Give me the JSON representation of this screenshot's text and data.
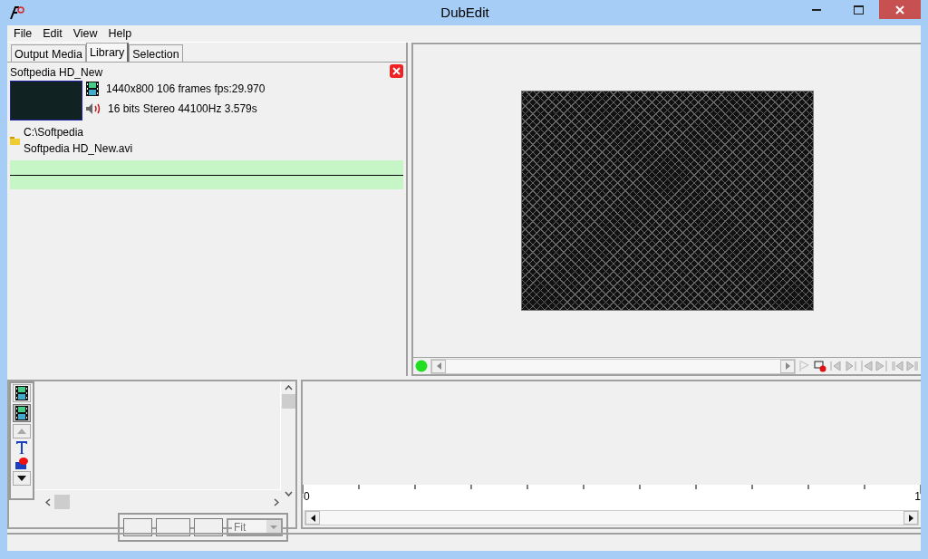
{
  "window": {
    "title": "DubEdit"
  },
  "menu": [
    "File",
    "Edit",
    "View",
    "Help"
  ],
  "tabs": [
    {
      "label": "Output Media",
      "selected": false
    },
    {
      "label": "Library",
      "selected": true
    },
    {
      "label": "Selection",
      "selected": false
    }
  ],
  "library": [
    {
      "name": "Softpedia HD_New",
      "video_info": "1440x800  106 frames  fps:29.970",
      "audio_info": "16 bits Stereo 44100Hz 3.579s",
      "folder": "C:\\Softpedia",
      "filename": "Softpedia HD_New.avi"
    }
  ],
  "tools": [
    {
      "kind": "film",
      "selected": false
    },
    {
      "kind": "film",
      "selected": true
    },
    {
      "kind": "up"
    },
    {
      "kind": "text"
    },
    {
      "kind": "shape"
    },
    {
      "kind": "down"
    }
  ],
  "zoom": {
    "value": "Fit"
  },
  "ruler": {
    "start": "0",
    "end": "1"
  }
}
